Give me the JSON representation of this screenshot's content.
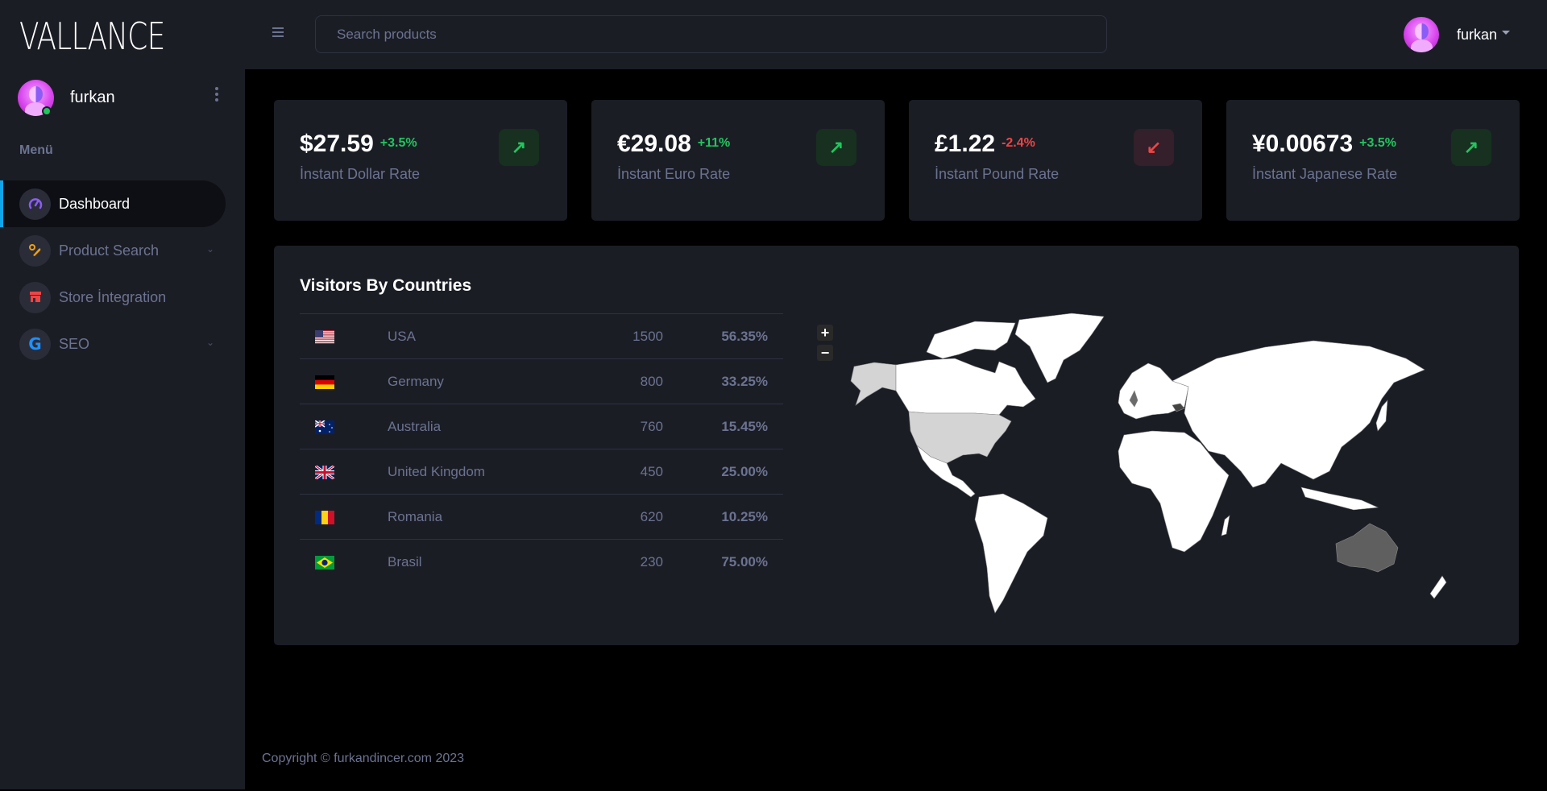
{
  "app": {
    "logo": "VALLANCE"
  },
  "sidebar": {
    "user": {
      "name": "furkan",
      "status": "online"
    },
    "menu_label": "Menü",
    "items": [
      {
        "label": "Dashboard",
        "icon": "speedometer-icon",
        "active": true,
        "expandable": false
      },
      {
        "label": "Product Search",
        "icon": "search-product-icon",
        "active": false,
        "expandable": true
      },
      {
        "label": "Store İntegration",
        "icon": "store-icon",
        "active": false,
        "expandable": false
      },
      {
        "label": "SEO",
        "icon": "google-icon",
        "active": false,
        "expandable": true
      }
    ]
  },
  "topbar": {
    "search_placeholder": "Search products",
    "user_name": "furkan"
  },
  "cards": [
    {
      "value": "$27.59",
      "change": "+3.5%",
      "trend": "up",
      "label": "İnstant Dollar Rate"
    },
    {
      "value": "€29.08",
      "change": "+11%",
      "trend": "up",
      "label": "İnstant Euro Rate"
    },
    {
      "value": "£1.22",
      "change": "-2.4%",
      "trend": "down",
      "label": "İnstant Pound Rate"
    },
    {
      "value": "¥0.00673",
      "change": "+3.5%",
      "trend": "up",
      "label": "İnstant Japanese Rate"
    }
  ],
  "visitors": {
    "title": "Visitors By Countries",
    "rows": [
      {
        "country": "USA",
        "flag": "us",
        "visitors": "1500",
        "percent": "56.35%"
      },
      {
        "country": "Germany",
        "flag": "de",
        "visitors": "800",
        "percent": "33.25%"
      },
      {
        "country": "Australia",
        "flag": "au",
        "visitors": "760",
        "percent": "15.45%"
      },
      {
        "country": "United Kingdom",
        "flag": "gb",
        "visitors": "450",
        "percent": "25.00%"
      },
      {
        "country": "Romania",
        "flag": "ro",
        "visitors": "620",
        "percent": "10.25%"
      },
      {
        "country": "Brasil",
        "flag": "br",
        "visitors": "230",
        "percent": "75.00%"
      }
    ],
    "map": {
      "zoom_in": "+",
      "zoom_out": "−",
      "highlight_colors": {
        "USA": "#d4d4d4",
        "Alaska": "#d4d4d4",
        "Australia": "#5f5f5f",
        "United Kingdom": "#6b6b6b",
        "Romania": "#444444",
        "default": "#ffffff"
      }
    }
  },
  "footer": {
    "text": "Copyright © furkandincer.com 2023"
  }
}
